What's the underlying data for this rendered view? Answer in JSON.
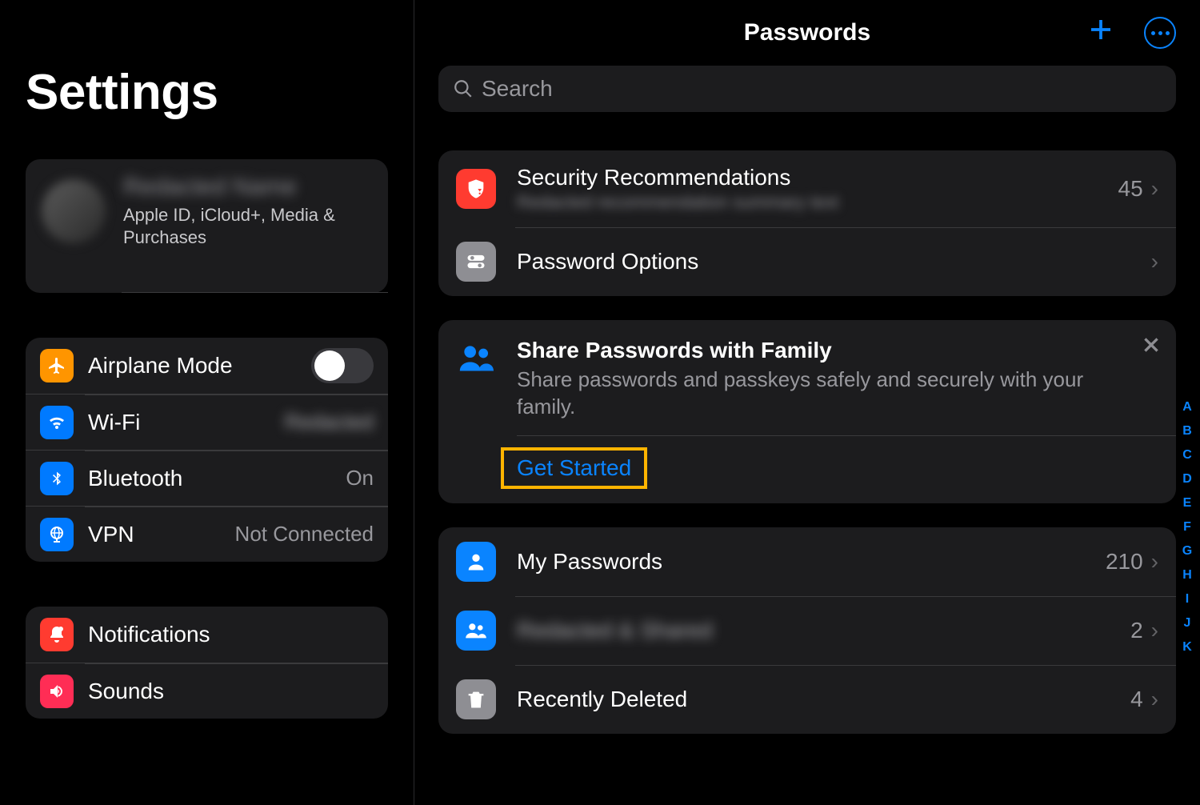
{
  "sidebar": {
    "title": "Settings",
    "profile": {
      "name": "Redacted Name",
      "subtitle": "Apple ID, iCloud+, Media & Purchases"
    },
    "group1": {
      "airplane": {
        "label": "Airplane Mode"
      },
      "wifi": {
        "label": "Wi-Fi",
        "value": "Redacted"
      },
      "bluetooth": {
        "label": "Bluetooth",
        "value": "On"
      },
      "vpn": {
        "label": "VPN",
        "value": "Not Connected"
      }
    },
    "group2": {
      "notifications": {
        "label": "Notifications"
      },
      "sounds": {
        "label": "Sounds"
      }
    }
  },
  "detail": {
    "title": "Passwords",
    "search_placeholder": "Search",
    "section1": {
      "security": {
        "label": "Security Recommendations",
        "sub": "Redacted recommendation summary text",
        "count": "45"
      },
      "options": {
        "label": "Password Options"
      }
    },
    "promo": {
      "title": "Share Passwords with Family",
      "desc": "Share passwords and passkeys safely and securely with your family.",
      "action": "Get Started"
    },
    "section2": {
      "my": {
        "label": "My Passwords",
        "count": "210"
      },
      "shared_group": {
        "label": "Redacted & Shared",
        "count": "2"
      },
      "deleted": {
        "label": "Recently Deleted",
        "count": "4"
      }
    },
    "alpha_index": [
      "A",
      "B",
      "C",
      "D",
      "E",
      "F",
      "G",
      "H",
      "I",
      "J",
      "K"
    ]
  }
}
